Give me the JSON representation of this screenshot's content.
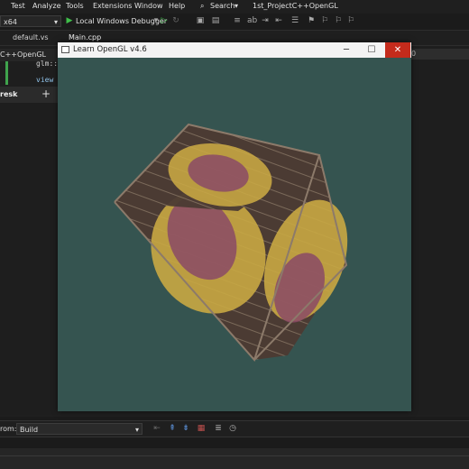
{
  "menu": {
    "items": [
      "Test",
      "Analyze",
      "Tools",
      "Extensions",
      "Window",
      "Help"
    ],
    "search_label": "Search",
    "project_name": "1st_ProjectC++OpenGL"
  },
  "toolbar": {
    "platform": "x64",
    "debugger_label": "Local Windows Debugger"
  },
  "doc_tabs": {
    "tab1": "default.vs",
    "tab2": "Main.cpp",
    "project_label": "C++OpenGL"
  },
  "code": {
    "line1": "glm::",
    "line2": "view"
  },
  "side": {
    "left_label": "resk",
    "add_tab": "+",
    "right_digit": "0"
  },
  "output": {
    "from_label": "rom:",
    "from_value": "Build"
  },
  "gl_window": {
    "title": "Learn OpenGL v4.6",
    "background_color": "#355450",
    "cube_colors": [
      "#4a3a32",
      "#c9a843",
      "#8a4a66"
    ]
  }
}
